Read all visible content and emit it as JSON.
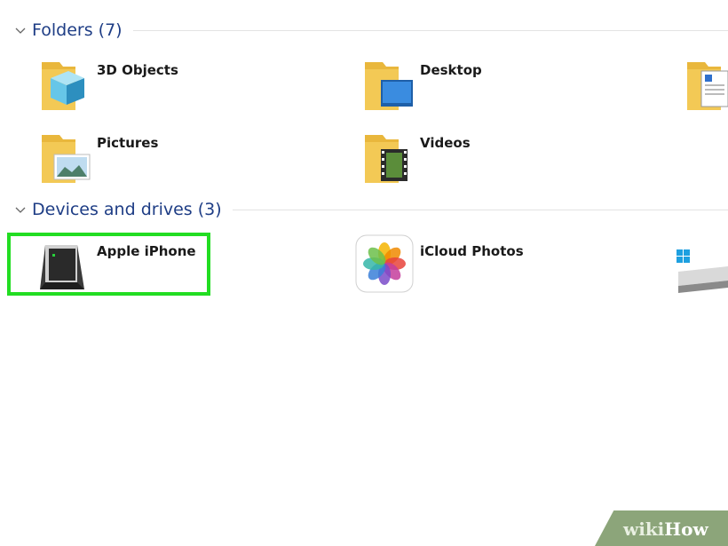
{
  "sections": {
    "folders": {
      "title": "Folders (7)"
    },
    "devices": {
      "title": "Devices and drives (3)"
    }
  },
  "folders": [
    {
      "label": "3D Objects"
    },
    {
      "label": "Desktop"
    },
    {
      "label": "Pictures"
    },
    {
      "label": "Videos"
    }
  ],
  "devices": [
    {
      "label": "Apple iPhone"
    },
    {
      "label": "iCloud Photos"
    }
  ],
  "watermark": {
    "wiki": "wiki",
    "how": "How"
  },
  "colors": {
    "section_title": "#1e3d85",
    "highlight": "#22dd22",
    "folder_yellow": "#f3c955"
  },
  "icons": {
    "folder": "folder-icon",
    "chevron": "chevron-down-icon",
    "device": "external-drive-icon",
    "photos": "icloud-photos-icon",
    "windows_drive": "windows-drive-icon",
    "document_folder": "documents-folder-icon"
  }
}
